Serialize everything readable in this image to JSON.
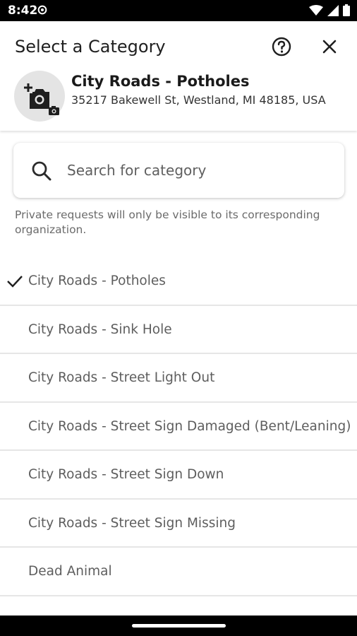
{
  "status": {
    "time": "8:42"
  },
  "header": {
    "title": "Select a Category",
    "icons": {
      "help": "help-circle-icon",
      "close": "close-icon",
      "photo": "add-photo-icon"
    }
  },
  "selected": {
    "title": "City Roads - Potholes",
    "address": "35217 Bakewell St, Westland, MI 48185, USA"
  },
  "search": {
    "placeholder": "Search for category",
    "value": ""
  },
  "note": "Private requests will only be visible to its corresponding organization.",
  "categories": [
    {
      "label": "City Roads - Potholes",
      "selected": true
    },
    {
      "label": "City Roads - Sink Hole",
      "selected": false
    },
    {
      "label": "City Roads - Street Light Out",
      "selected": false
    },
    {
      "label": "City Roads - Street Sign Damaged (Bent/Leaning)",
      "selected": false
    },
    {
      "label": "City Roads - Street Sign Down",
      "selected": false
    },
    {
      "label": "City Roads - Street Sign Missing",
      "selected": false
    },
    {
      "label": "Dead Animal",
      "selected": false
    }
  ]
}
